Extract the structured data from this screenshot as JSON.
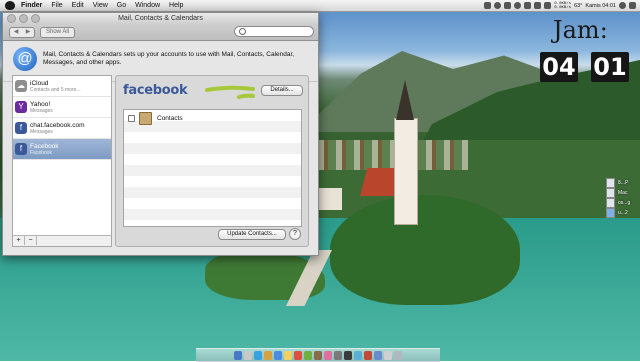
{
  "menubar": {
    "items": [
      "Finder",
      "File",
      "Edit",
      "View",
      "Go",
      "Window",
      "Help"
    ],
    "net_up": "0.0KB/s",
    "net_down": "0.0KB/s",
    "temperature": "63°",
    "clock": "Kamis 04:01",
    "icons": [
      "apple-icon",
      "wifi-icon",
      "volume-icon",
      "battery-icon",
      "spotlight-icon"
    ]
  },
  "desktop_clock": {
    "label": "Jam:",
    "hour": "04",
    "minute": "01"
  },
  "desktop_icons": [
    {
      "label": "8...P",
      "icon": "document-icon"
    },
    {
      "label": "Mac",
      "icon": "document-icon"
    },
    {
      "label": "os...g",
      "icon": "document-icon"
    },
    {
      "label": "u...2",
      "icon": "folder-icon"
    }
  ],
  "window": {
    "title": "Mail, Contacts & Calendars",
    "show_all": "Show All",
    "search_placeholder": "",
    "intro": "Mail, Contacts & Calendars sets up your accounts to use with Mail, Contacts, Calendar, Messages, and other apps."
  },
  "accounts": [
    {
      "name": "iCloud",
      "sub": "Contacts and 5 more...",
      "color": "#8e8e8e",
      "glyph": "☁"
    },
    {
      "name": "Yahoo!",
      "sub": "Messages",
      "color": "#6a2aa0",
      "glyph": "Y"
    },
    {
      "name": "chat.facebook.com",
      "sub": "Messages",
      "color": "#3b5998",
      "glyph": "f"
    },
    {
      "name": "Facebook",
      "sub": "Facebook",
      "color": "#3b5998",
      "glyph": "f",
      "selected": true
    }
  ],
  "sidebar_footer": {
    "add": "+",
    "remove": "−"
  },
  "detail": {
    "logo": "facebook",
    "details_button": "Details...",
    "services": [
      {
        "label": "Contacts",
        "checked": false
      }
    ],
    "update_button": "Update Contacts...",
    "help_button": "?"
  },
  "colors": {
    "facebook_blue": "#3b5998",
    "selection": "#8aa4cc",
    "highlight_scribble": "#a6c83a"
  }
}
